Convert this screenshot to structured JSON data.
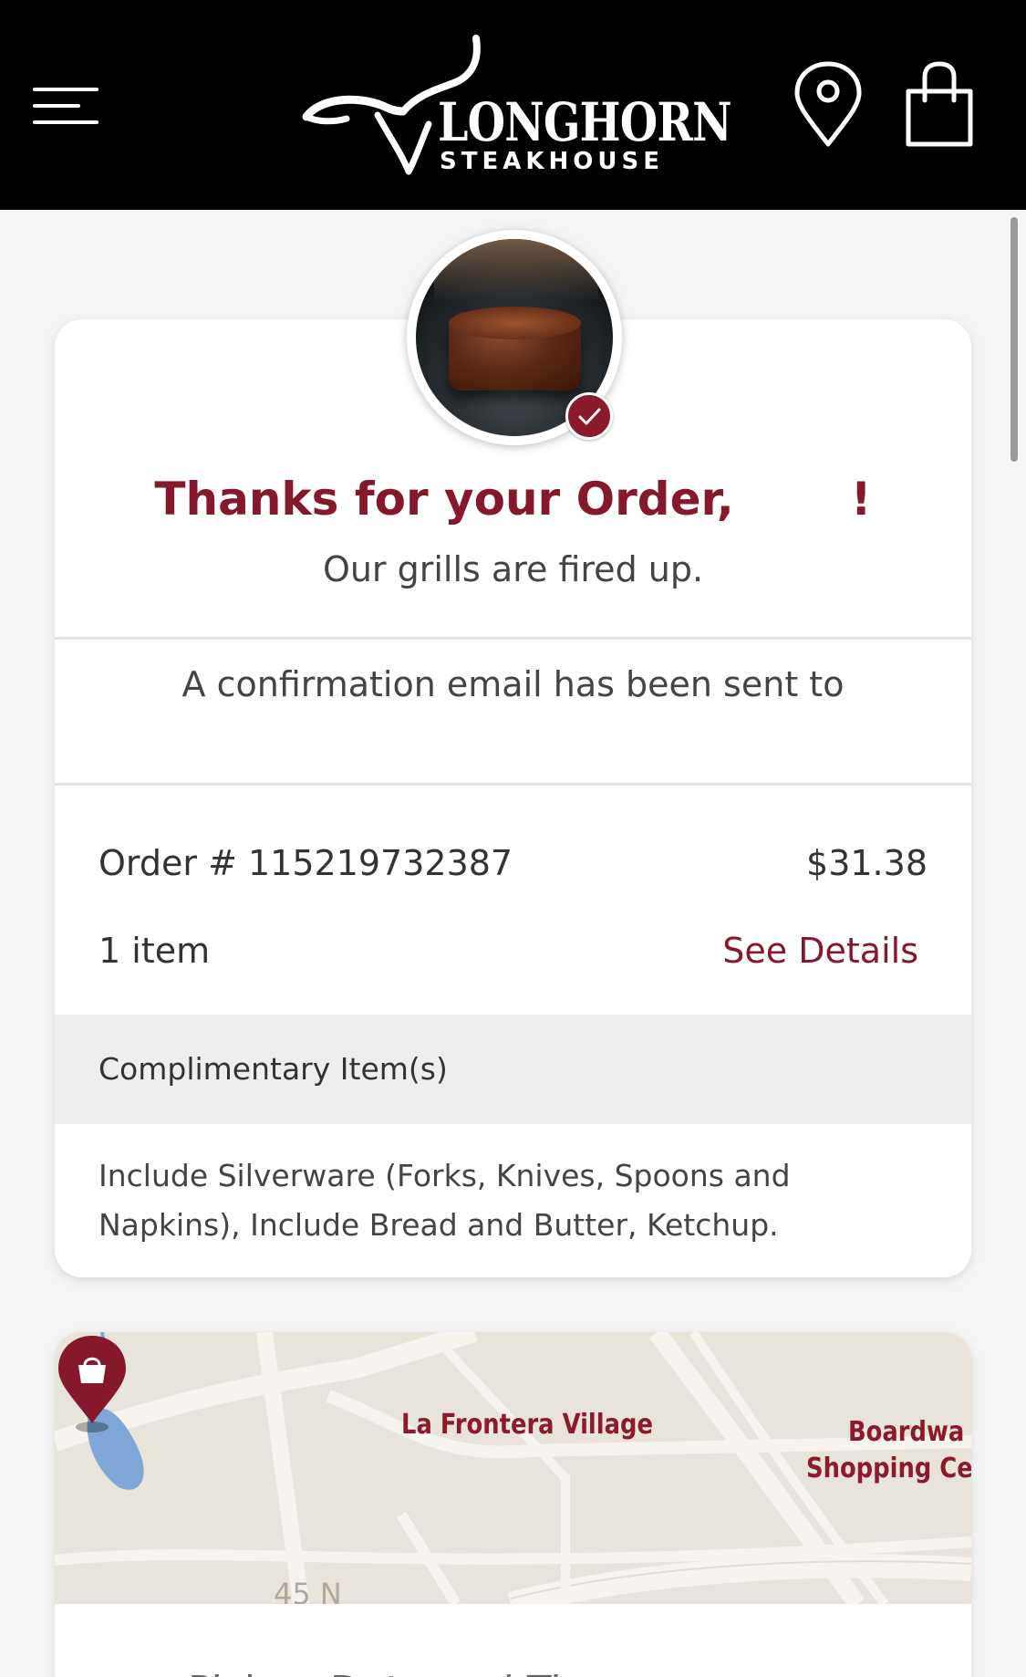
{
  "header": {
    "logo_word": "LONGHORN",
    "logo_sub": "STEAKHOUSE",
    "brand_color": "#000000"
  },
  "order_card": {
    "thanks_prefix": "Thanks for your Order,",
    "thanks_suffix": "!",
    "subtitle": "Our grills are fired up.",
    "confirmation_text": "A confirmation email has been sent to",
    "order_number": "Order # 115219732387",
    "order_total": "$31.38",
    "item_count": "1 item",
    "see_details": "See Details",
    "complimentary_title": "Complimentary Item(s)",
    "complimentary_items": "Include Silverware (Forks, Knives, Spoons and Napkins), Include Bread and Butter, Ketchup.",
    "accent_color": "#85182a"
  },
  "map_card": {
    "label_village": "La Frontera Village",
    "label_boardwalk_1": "Boardwa",
    "label_boardwalk_2": "Shopping Ce",
    "road_label": "45 N",
    "pickup_label": "Pickup Date and Time"
  },
  "icons": [
    "menu-icon",
    "location-pin-icon",
    "shopping-bag-icon",
    "check-icon",
    "store-pin-icon",
    "clock-icon"
  ]
}
